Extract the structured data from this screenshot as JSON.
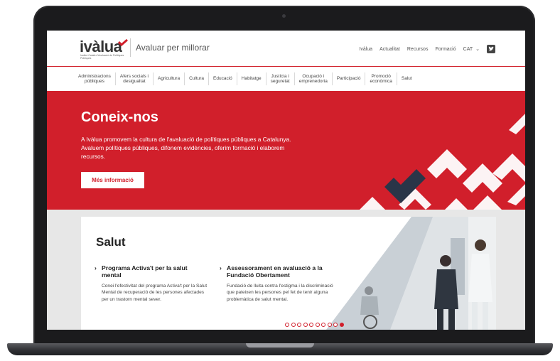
{
  "header": {
    "logo_text": "ivàlua",
    "logo_subtitle": "Institut Català d'Avaluació de Polítiques Públiques",
    "tagline": "Avaluar per millorar",
    "top_links": [
      "Ivàlua",
      "Actualitat",
      "Recursos",
      "Formació"
    ],
    "language": "CAT"
  },
  "categories": [
    "Administracions\npúbliques",
    "Afers socials i\ndesigualtat",
    "Agricultura",
    "Cultura",
    "Educació",
    "Habitatge",
    "Justícia i\nseguretat",
    "Ocupació i\nemprenedoria",
    "Participació",
    "Promoció\neconòmica",
    "Salut"
  ],
  "hero": {
    "title": "Coneix-nos",
    "text": "A Ivàlua promovem la cultura de l'avaluació de polítiques públiques a Catalunya. Avaluem polítiques públiques, difonem evidències, oferim formació i elaborem recursos.",
    "button_label": "Més informació"
  },
  "section": {
    "title": "Salut",
    "articles": [
      {
        "title": "Programa Activa't per la salut mental",
        "text": "Conei l'efectivitat del programa Activa't per la Salut Mental de recuperació de les persones afectades per un trastorn mental sever."
      },
      {
        "title": "Assessorament en avaluació a la Fundació Obertament",
        "text": "Fundació de lluita contra l'estigma i la discriminació que pateixen les persones pel fet de tenir alguna problemàtica de salut mental."
      }
    ],
    "carousel": {
      "total": 10,
      "active": 10
    }
  },
  "colors": {
    "brand_red": "#d11f2b",
    "dark_navy": "#2a3548"
  }
}
